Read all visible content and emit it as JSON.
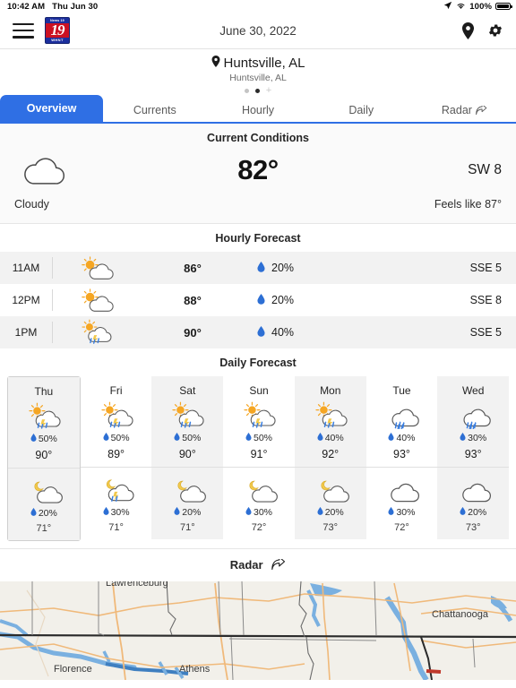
{
  "statusbar": {
    "time": "10:42 AM",
    "date": "Thu Jun 30",
    "battery_pct": "100%"
  },
  "appbar": {
    "title": "June 30, 2022",
    "logo_top": "News 19",
    "logo_number": "19",
    "logo_bottom": "WHNT"
  },
  "location": {
    "name": "Huntsville, AL",
    "sub": "Huntsville, AL"
  },
  "tabs": [
    {
      "label": "Overview",
      "active": true
    },
    {
      "label": "Currents",
      "active": false
    },
    {
      "label": "Hourly",
      "active": false
    },
    {
      "label": "Daily",
      "active": false
    },
    {
      "label": "Radar",
      "active": false,
      "share": true
    }
  ],
  "current": {
    "title": "Current Conditions",
    "icon": "cloudy",
    "temp": "82°",
    "wind": "SW 8",
    "condition": "Cloudy",
    "feels_like": "Feels like 87°"
  },
  "hourly": {
    "title": "Hourly Forecast",
    "rows": [
      {
        "time": "11AM",
        "icon": "partly-sunny",
        "temp": "86°",
        "pop": "20%",
        "wind": "SSE 5"
      },
      {
        "time": "12PM",
        "icon": "partly-sunny",
        "temp": "88°",
        "pop": "20%",
        "wind": "SSE 8"
      },
      {
        "time": "1PM",
        "icon": "sun-thunder",
        "temp": "90°",
        "pop": "40%",
        "wind": "SSE 5"
      }
    ]
  },
  "daily": {
    "title": "Daily Forecast",
    "days": [
      {
        "day": "Thu",
        "today": true,
        "day_icon": "sun-thunder",
        "day_pop": "50%",
        "high": "90°",
        "night_icon": "moon-cloud",
        "night_pop": "20%",
        "low": "71°"
      },
      {
        "day": "Fri",
        "today": false,
        "day_icon": "sun-thunder",
        "day_pop": "50%",
        "high": "89°",
        "night_icon": "moon-thunder",
        "night_pop": "30%",
        "low": "71°"
      },
      {
        "day": "Sat",
        "today": false,
        "day_icon": "sun-thunder",
        "day_pop": "50%",
        "high": "90°",
        "night_icon": "moon-cloud",
        "night_pop": "20%",
        "low": "71°"
      },
      {
        "day": "Sun",
        "today": false,
        "day_icon": "sun-thunder",
        "day_pop": "50%",
        "high": "91°",
        "night_icon": "moon-cloud",
        "night_pop": "30%",
        "low": "72°"
      },
      {
        "day": "Mon",
        "today": false,
        "day_icon": "sun-thunder",
        "day_pop": "40%",
        "high": "92°",
        "night_icon": "moon-cloud",
        "night_pop": "20%",
        "low": "73°"
      },
      {
        "day": "Tue",
        "today": false,
        "day_icon": "cloud-rain",
        "day_pop": "40%",
        "high": "93°",
        "night_icon": "cloudy",
        "night_pop": "30%",
        "low": "72°"
      },
      {
        "day": "Wed",
        "today": false,
        "day_icon": "cloud-rain",
        "day_pop": "30%",
        "high": "93°",
        "night_icon": "cloudy",
        "night_pop": "20%",
        "low": "73°"
      }
    ]
  },
  "radar": {
    "title": "Radar",
    "map_labels": [
      "Lawrenceburg",
      "Chattanooga",
      "Florence",
      "Athens"
    ]
  },
  "colors": {
    "accent": "#2f6fe4",
    "rain_drop": "#2d6fd4",
    "sun": "#f5a623",
    "moon": "#f2c94c",
    "map_bg": "#f2f0ea",
    "map_water": "#7ab0e0",
    "map_road": "#f0b97a"
  }
}
